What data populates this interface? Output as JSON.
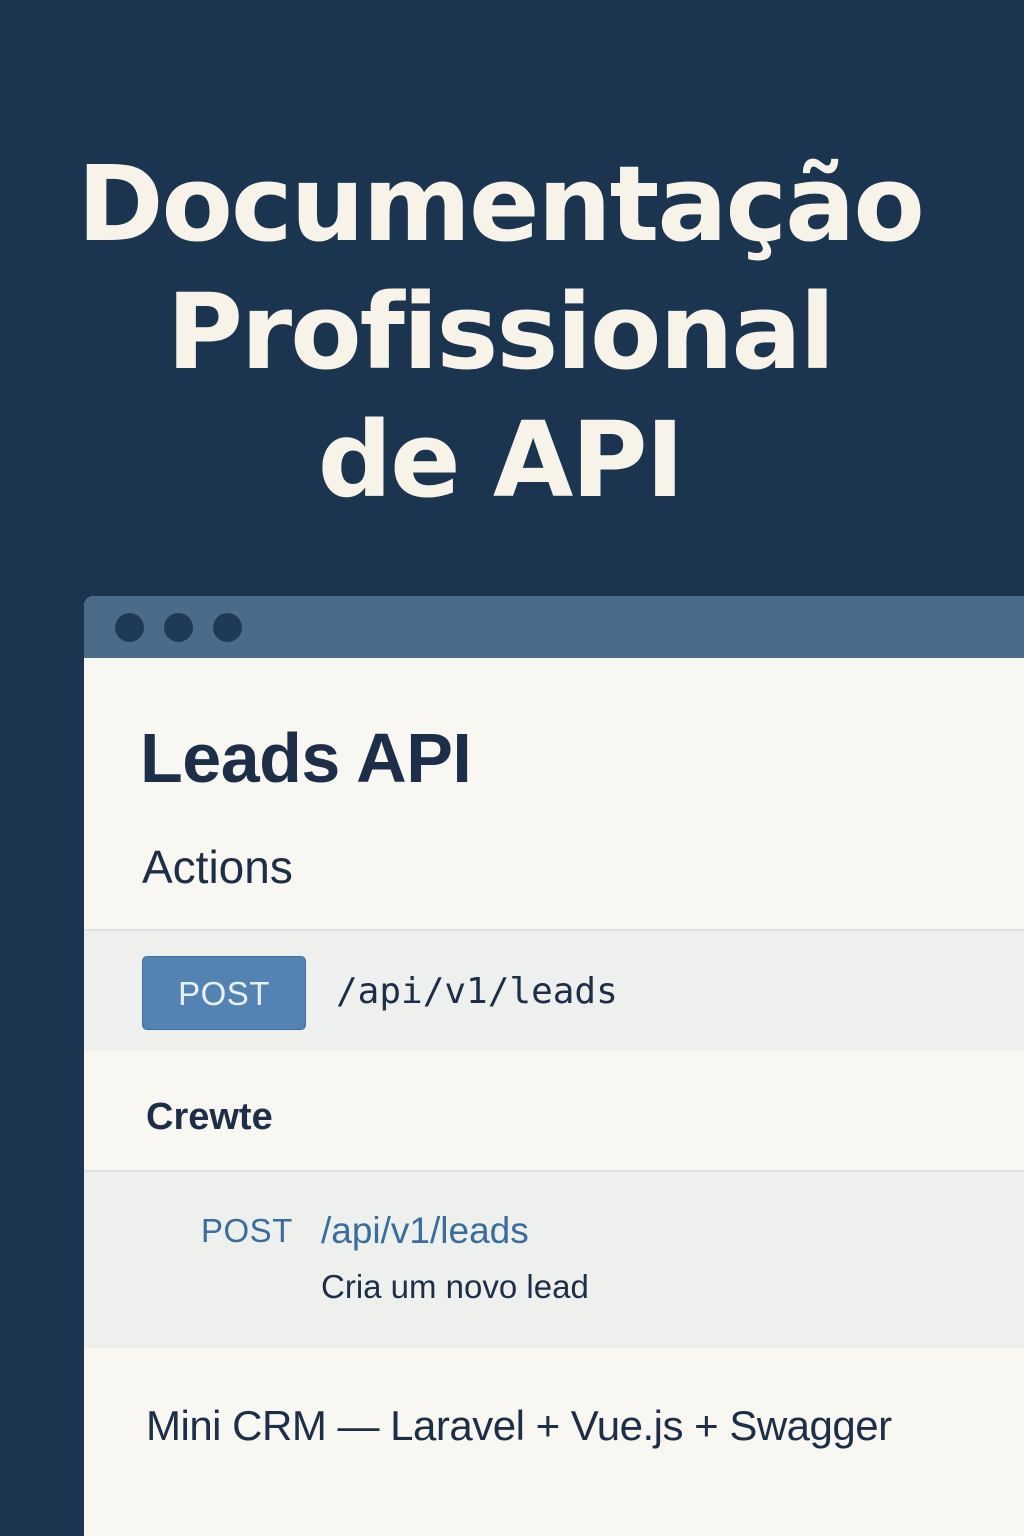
{
  "hero": {
    "line1": "Documentação",
    "line2": "Profissional",
    "line3": "de API"
  },
  "window": {
    "title": "Leads API",
    "actions_label": "Actions",
    "endpoint": {
      "method": "POST",
      "path": "/api/v1/leads"
    },
    "section_label": "Crewte",
    "operation": {
      "method": "POST",
      "path": "/api/v1/leads",
      "description": "Cria um novo lead"
    },
    "footer": "Mini CRM — Laravel + Vue.js + Swagger"
  },
  "colors": {
    "background": "#1b3550",
    "titlebar": "#4a6c8a",
    "badge": "#5283b3",
    "text_dark": "#1d2f48",
    "link": "#3a6c9e"
  }
}
